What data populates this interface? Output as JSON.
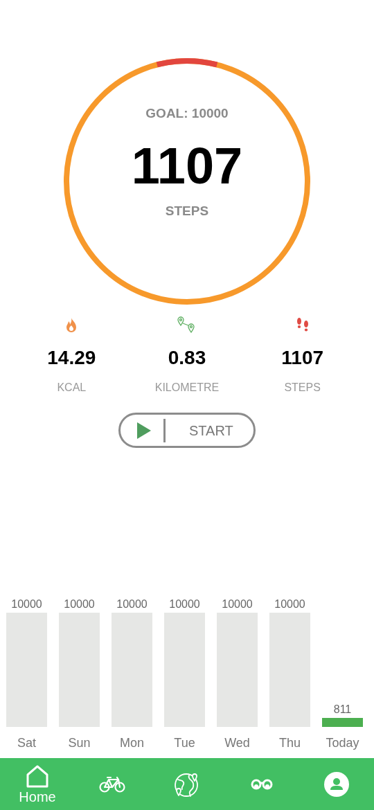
{
  "ring": {
    "goal": "GOAL: 10000",
    "value": "1107",
    "unit": "STEPS",
    "level": 0.08
  },
  "stats": [
    {
      "kind": "flame",
      "value": "14.29",
      "label": "KCAL"
    },
    {
      "kind": "pins",
      "value": "0.83",
      "label": "KILOMETRE"
    },
    {
      "kind": "footprints",
      "value": "1107",
      "label": "STEPS"
    }
  ],
  "start_button": {
    "label": "START"
  },
  "chart_data": {
    "type": "bar",
    "categories": [
      "Sat",
      "Sun",
      "Mon",
      "Tue",
      "Wed",
      "Thu",
      "Today"
    ],
    "data_labels": true,
    "series": [
      {
        "color": "#e6e7e5",
        "values": [
          10000,
          10000,
          10000,
          10000,
          10000,
          10000,
          null
        ]
      },
      {
        "color": "#4caf50",
        "values": [
          null,
          null,
          null,
          null,
          null,
          null,
          811
        ]
      }
    ]
  },
  "nav": [
    {
      "kind": "home",
      "label": "Home"
    },
    {
      "kind": "bicycle"
    },
    {
      "kind": "globe"
    },
    {
      "kind": "binoculars"
    },
    {
      "kind": "profile"
    }
  ]
}
